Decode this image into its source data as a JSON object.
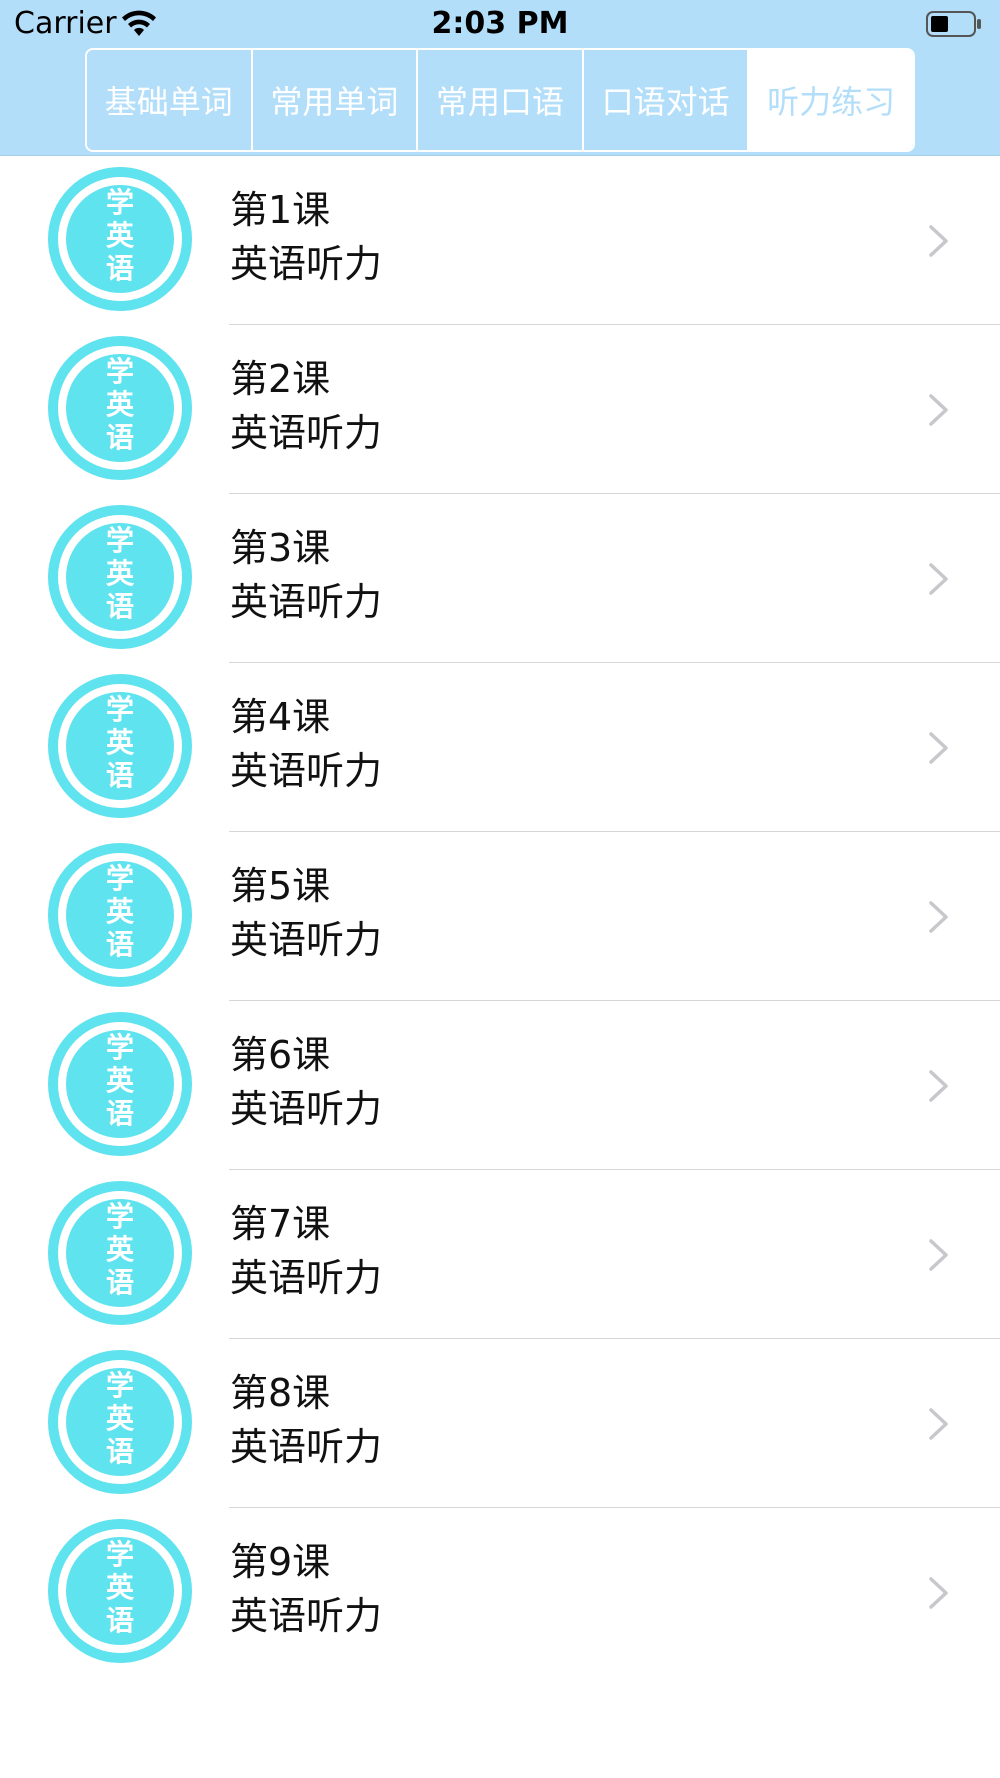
{
  "status_bar": {
    "carrier": "Carrier",
    "time": "2:03 PM"
  },
  "tabs": [
    {
      "label": "基础单词",
      "active": false
    },
    {
      "label": "常用单词",
      "active": false
    },
    {
      "label": "常用口语",
      "active": false
    },
    {
      "label": "口语对话",
      "active": false
    },
    {
      "label": "听力练习",
      "active": true
    }
  ],
  "avatar_text": "学英语",
  "lessons": [
    {
      "title": "第1课",
      "subtitle": "英语听力"
    },
    {
      "title": "第2课",
      "subtitle": "英语听力"
    },
    {
      "title": "第3课",
      "subtitle": "英语听力"
    },
    {
      "title": "第4课",
      "subtitle": "英语听力"
    },
    {
      "title": "第5课",
      "subtitle": "英语听力"
    },
    {
      "title": "第6课",
      "subtitle": "英语听力"
    },
    {
      "title": "第7课",
      "subtitle": "英语听力"
    },
    {
      "title": "第8课",
      "subtitle": "英语听力"
    },
    {
      "title": "第9课",
      "subtitle": "英语听力"
    }
  ],
  "colors": {
    "header_bg": "#b3defa",
    "avatar_ring": "#5fe3ef",
    "separator": "#d6d6d6",
    "chevron": "#c7c7cc"
  },
  "icons": {
    "wifi": "wifi-icon",
    "battery": "battery-icon",
    "chevron": "chevron-right-icon"
  }
}
